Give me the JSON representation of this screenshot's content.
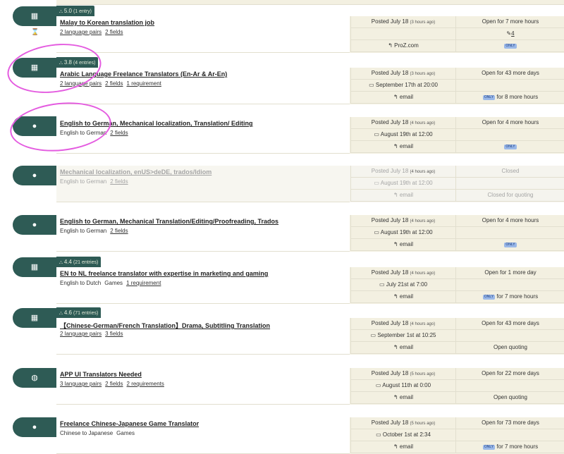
{
  "jobs": [
    {
      "title": "Malay to Korean translation job",
      "rating_score": "5.0",
      "rating_entries": "(1 entry)",
      "sub": [
        {
          "text": "2 language pairs",
          "link": true
        },
        {
          "text": "2 fields",
          "link": true
        }
      ],
      "posted": "Posted July 18",
      "posted_ago": "(3 hours ago)",
      "open": "Open for 7 more hours",
      "deadline": "",
      "quotes": "4",
      "reply_via": "ProZ.com",
      "col2_row3": "ONLY"
    },
    {
      "title": "Arabic Language Freelance Translators (En-Ar & Ar-En)",
      "rating_score": "3.8",
      "rating_entries": "(4 entries)",
      "sub": [
        {
          "text": "2 language pairs",
          "link": true
        },
        {
          "text": "2 fields",
          "link": true
        },
        {
          "text": "1 requirement",
          "link": true
        }
      ],
      "posted": "Posted July 18",
      "posted_ago": "(3 hours ago)",
      "open": "Open for 43 more days",
      "deadline": "September 17th at 20:00",
      "reply_via": "email",
      "col2_row3": "for 8 more hours"
    },
    {
      "title": "English to German, Mechanical localization, Translation/ Editing",
      "sub": [
        {
          "text": "English to German",
          "link": false
        },
        {
          "text": "2 fields",
          "link": true
        }
      ],
      "posted": "Posted July 18",
      "posted_ago": "(4 hours ago)",
      "open": "Open for 4 more hours",
      "deadline": "August 19th at 12:00",
      "reply_via": "email",
      "col2_row3": "ONLY"
    },
    {
      "title": "Mechanical localization, enUS>deDE, trados/Idiom",
      "sub": [
        {
          "text": "English to German",
          "link": false
        },
        {
          "text": "2 fields",
          "link": true
        }
      ],
      "posted": "Posted July 18",
      "posted_ago": "(4 hours ago)",
      "open": "Closed",
      "deadline": "August 19th at 12:00",
      "reply_via": "email",
      "col2_row3": "Closed for quoting"
    },
    {
      "title": "English to German, Mechanical Translation/Editing/Proofreading, Trados",
      "sub": [
        {
          "text": "English to German",
          "link": false
        },
        {
          "text": "2 fields",
          "link": true
        }
      ],
      "posted": "Posted July 18",
      "posted_ago": "(4 hours ago)",
      "open": "Open for 4 more hours",
      "deadline": "August 19th at 12:00",
      "reply_via": "email",
      "col2_row3": "ONLY"
    },
    {
      "title": "EN to NL freelance translator with expertise in marketing and gaming",
      "rating_score": "4.4",
      "rating_entries": "(21 entries)",
      "sub": [
        {
          "text": "English to Dutch",
          "link": false
        },
        {
          "text": "Games",
          "link": false
        },
        {
          "text": "1 requirement",
          "link": true
        }
      ],
      "posted": "Posted July 18",
      "posted_ago": "(4 hours ago)",
      "open": "Open for 1 more day",
      "deadline": "July 21st at 7:00",
      "reply_via": "email",
      "col2_row3": "for 7 more hours"
    },
    {
      "title": "【Chinese-German/French Translation】Drama,  Subtitling Translation",
      "rating_score": "4.6",
      "rating_entries": "(71 entries)",
      "sub": [
        {
          "text": "2 language pairs",
          "link": true
        },
        {
          "text": "3 fields",
          "link": true
        }
      ],
      "posted": "Posted July 18",
      "posted_ago": "(4 hours ago)",
      "open": "Open for 43 more days",
      "deadline": "September 1st at 10:25",
      "reply_via": "email",
      "col2_row3": "Open quoting"
    },
    {
      "title": "APP UI Translators Needed",
      "sub": [
        {
          "text": "3 language pairs",
          "link": true
        },
        {
          "text": "2 fields",
          "link": true
        },
        {
          "text": "2 requirements",
          "link": true
        }
      ],
      "posted": "Posted July 18",
      "posted_ago": "(5 hours ago)",
      "open": "Open for 22 more days",
      "deadline": "August 11th at 0:00",
      "reply_via": "email",
      "col2_row3": "Open quoting"
    },
    {
      "title": "Freelance Chinese-Japanese Game Translator",
      "sub": [
        {
          "text": "Chinese to Japanese",
          "link": false
        },
        {
          "text": "Games",
          "link": false
        }
      ],
      "posted": "Posted July 18",
      "posted_ago": "(5 hours ago)",
      "open": "Open for 73 more days",
      "deadline": "October 1st at 2:34",
      "reply_via": "email",
      "col2_row3": "for 7 more hours"
    }
  ],
  "colors": {
    "pill": "#2e5b55",
    "card": "#f3f0e1",
    "highlight": "#e45ce0",
    "only_badge": "#9ab8e8"
  },
  "icons": {
    "agency": "building-icon",
    "individual": "person-icon",
    "global": "globe-icon",
    "reply": "reply-arrow-icon",
    "calendar": "calendar-icon",
    "quote": "quote-icon",
    "hourglass": "hourglass-icon",
    "rating": "people-rating-icon"
  }
}
